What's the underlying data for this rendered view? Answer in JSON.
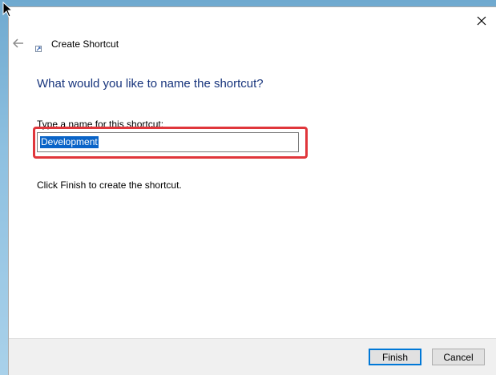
{
  "window": {
    "title": "Create Shortcut",
    "close_icon": "close-icon",
    "back_icon": "back-arrow-icon"
  },
  "content": {
    "heading": "What would you like to name the shortcut?",
    "name_label": "Type a name for this shortcut:",
    "name_value": "Development",
    "finish_hint": "Click Finish to create the shortcut."
  },
  "buttons": {
    "finish_label": "Finish",
    "cancel_label": "Cancel"
  },
  "colors": {
    "heading": "#17347c",
    "highlight": "#e0363b",
    "selection": "#0a64c8",
    "default_button_border": "#0078d7"
  }
}
